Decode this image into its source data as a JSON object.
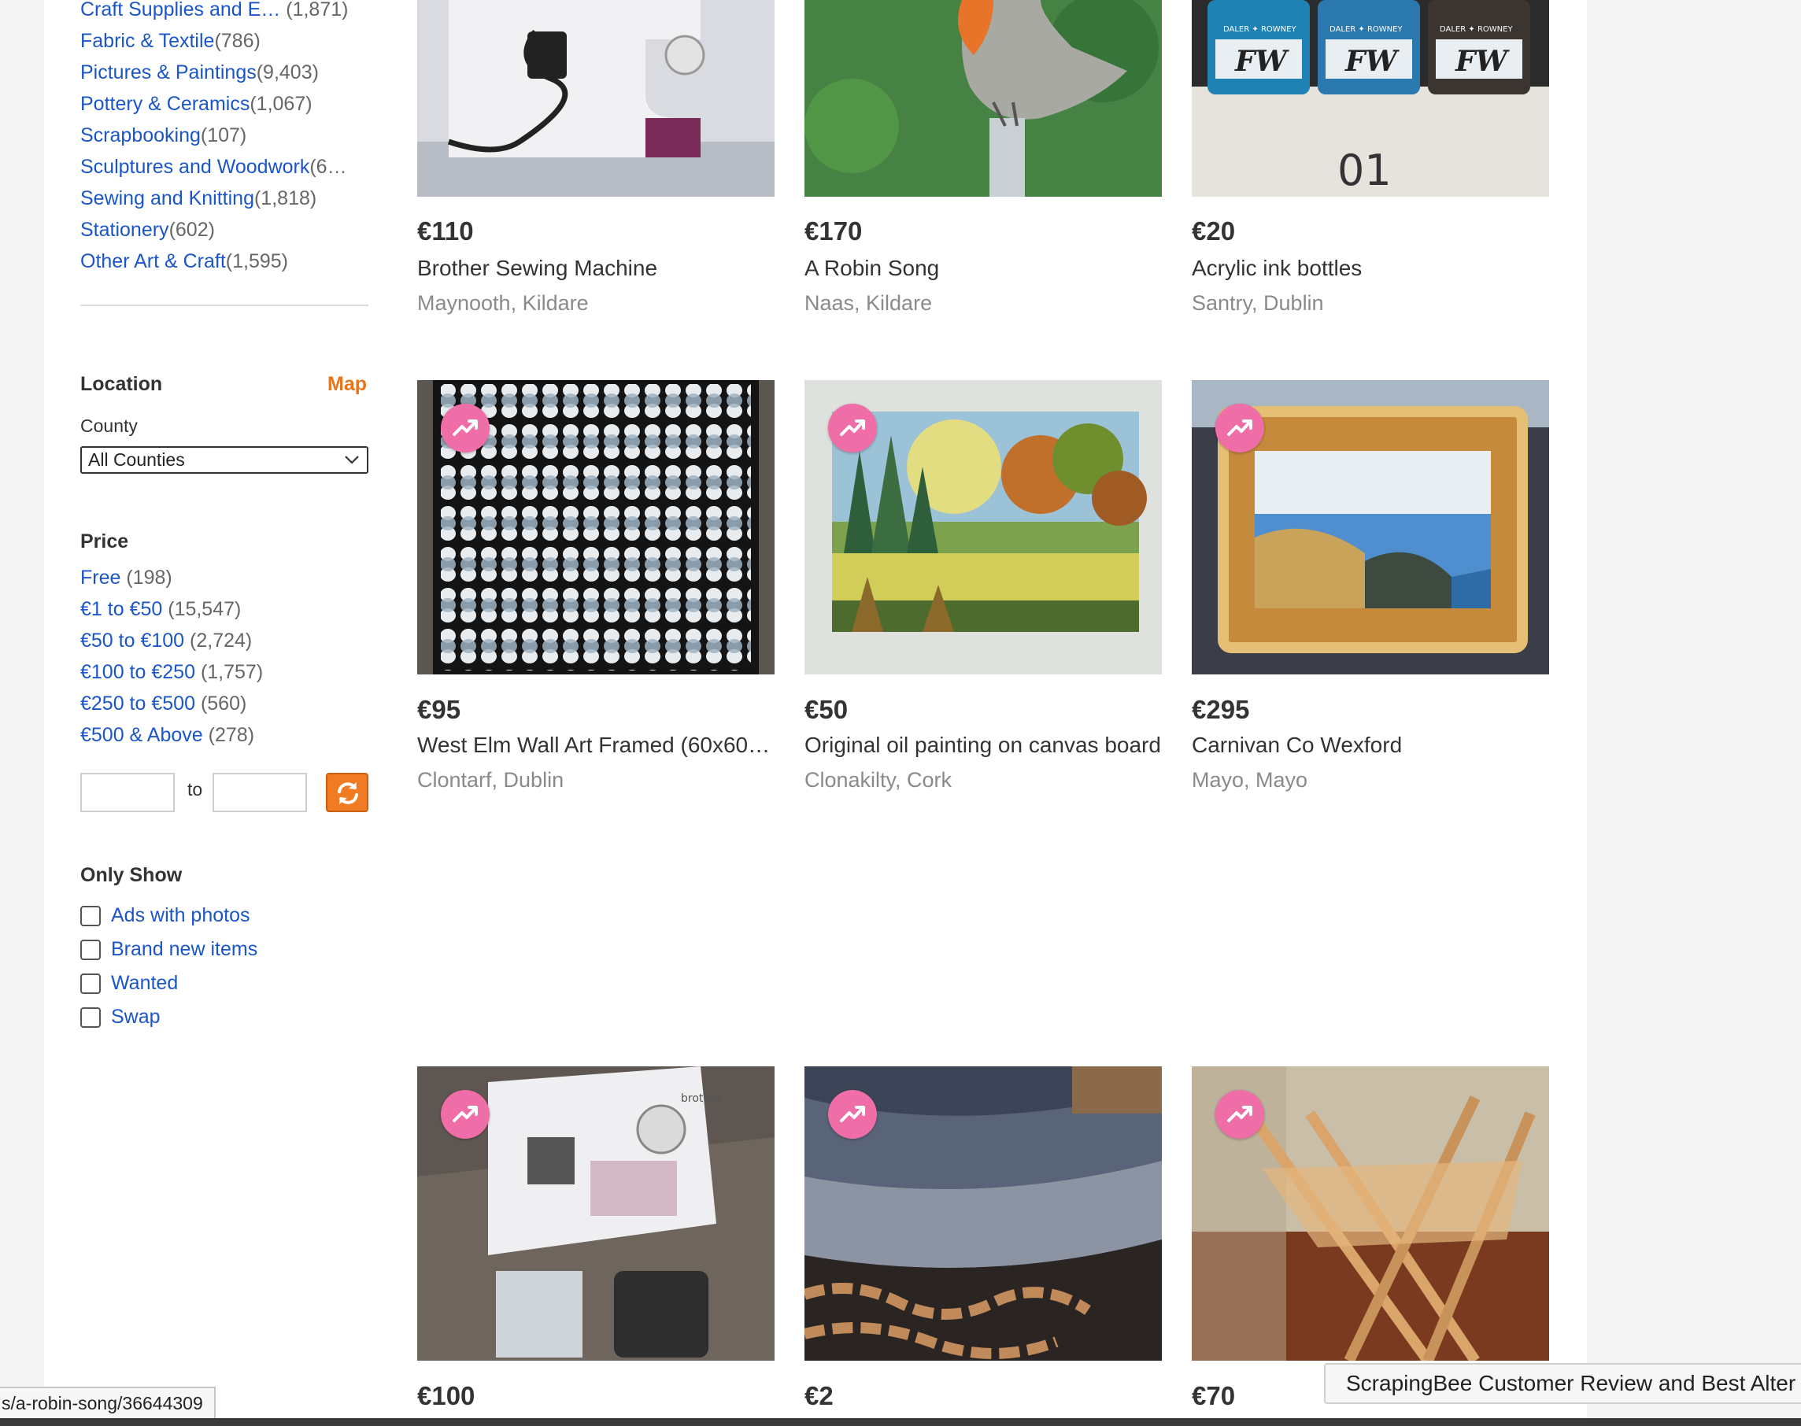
{
  "categories": [
    {
      "label": "Craft Supplies and E…",
      "count": "(1,871)"
    },
    {
      "label": "Fabric & Textile",
      "count": "(786)"
    },
    {
      "label": "Pictures & Paintings",
      "count": "(9,403)"
    },
    {
      "label": "Pottery & Ceramics",
      "count": "(1,067)"
    },
    {
      "label": "Scrapbooking",
      "count": "(107)"
    },
    {
      "label": "Sculptures and Woodwork",
      "count": "(6…"
    },
    {
      "label": "Sewing and Knitting",
      "count": "(1,818)"
    },
    {
      "label": "Stationery",
      "count": "(602)"
    },
    {
      "label": "Other Art & Craft",
      "count": "(1,595)"
    }
  ],
  "location": {
    "title": "Location",
    "map_link": "Map",
    "county_label": "County",
    "county_selected": "All Counties"
  },
  "price": {
    "title": "Price",
    "ranges": [
      {
        "label": "Free",
        "count": "(198)"
      },
      {
        "label": "€1 to €50",
        "count": "(15,547)"
      },
      {
        "label": "€50 to €100",
        "count": "(2,724)"
      },
      {
        "label": "€100 to €250",
        "count": "(1,757)"
      },
      {
        "label": "€250 to €500",
        "count": "(560)"
      },
      {
        "label": "€500 & Above",
        "count": "(278)"
      }
    ],
    "to_label": "to",
    "min_value": "",
    "max_value": ""
  },
  "only_show": {
    "title": "Only Show",
    "options": [
      "Ads with photos",
      "Brand new items",
      "Wanted",
      "Swap"
    ]
  },
  "listings": [
    {
      "price": "€110",
      "title": "Brother Sewing Machine",
      "location": "Maynooth, Kildare"
    },
    {
      "price": "€170",
      "title": "A Robin Song",
      "location": "Naas, Kildare"
    },
    {
      "price": "€20",
      "title": "Acrylic ink bottles",
      "location": "Santry, Dublin"
    },
    {
      "price": "€95",
      "title": "West Elm Wall Art Framed (60x60…",
      "location": "Clontarf, Dublin"
    },
    {
      "price": "€50",
      "title": "Original oil painting on canvas board",
      "location": "Clonakilty, Cork"
    },
    {
      "price": "€295",
      "title": "Carnivan Co Wexford",
      "location": "Mayo, Mayo"
    },
    {
      "price": "€100"
    },
    {
      "price": "€2"
    },
    {
      "price": "€70"
    }
  ],
  "image_text": {
    "ink_brand": "FW",
    "ink_label": "DALER ✦ ROWNEY",
    "box_text": "01",
    "machine_brand": "brother"
  },
  "status_url": "s/a-robin-song/36644309",
  "tooltip": "ScrapingBee Customer Review and Best Alter",
  "colors": {
    "link": "#1a56c8",
    "accent": "#e8741b",
    "spotlight": "#f06ea8"
  }
}
